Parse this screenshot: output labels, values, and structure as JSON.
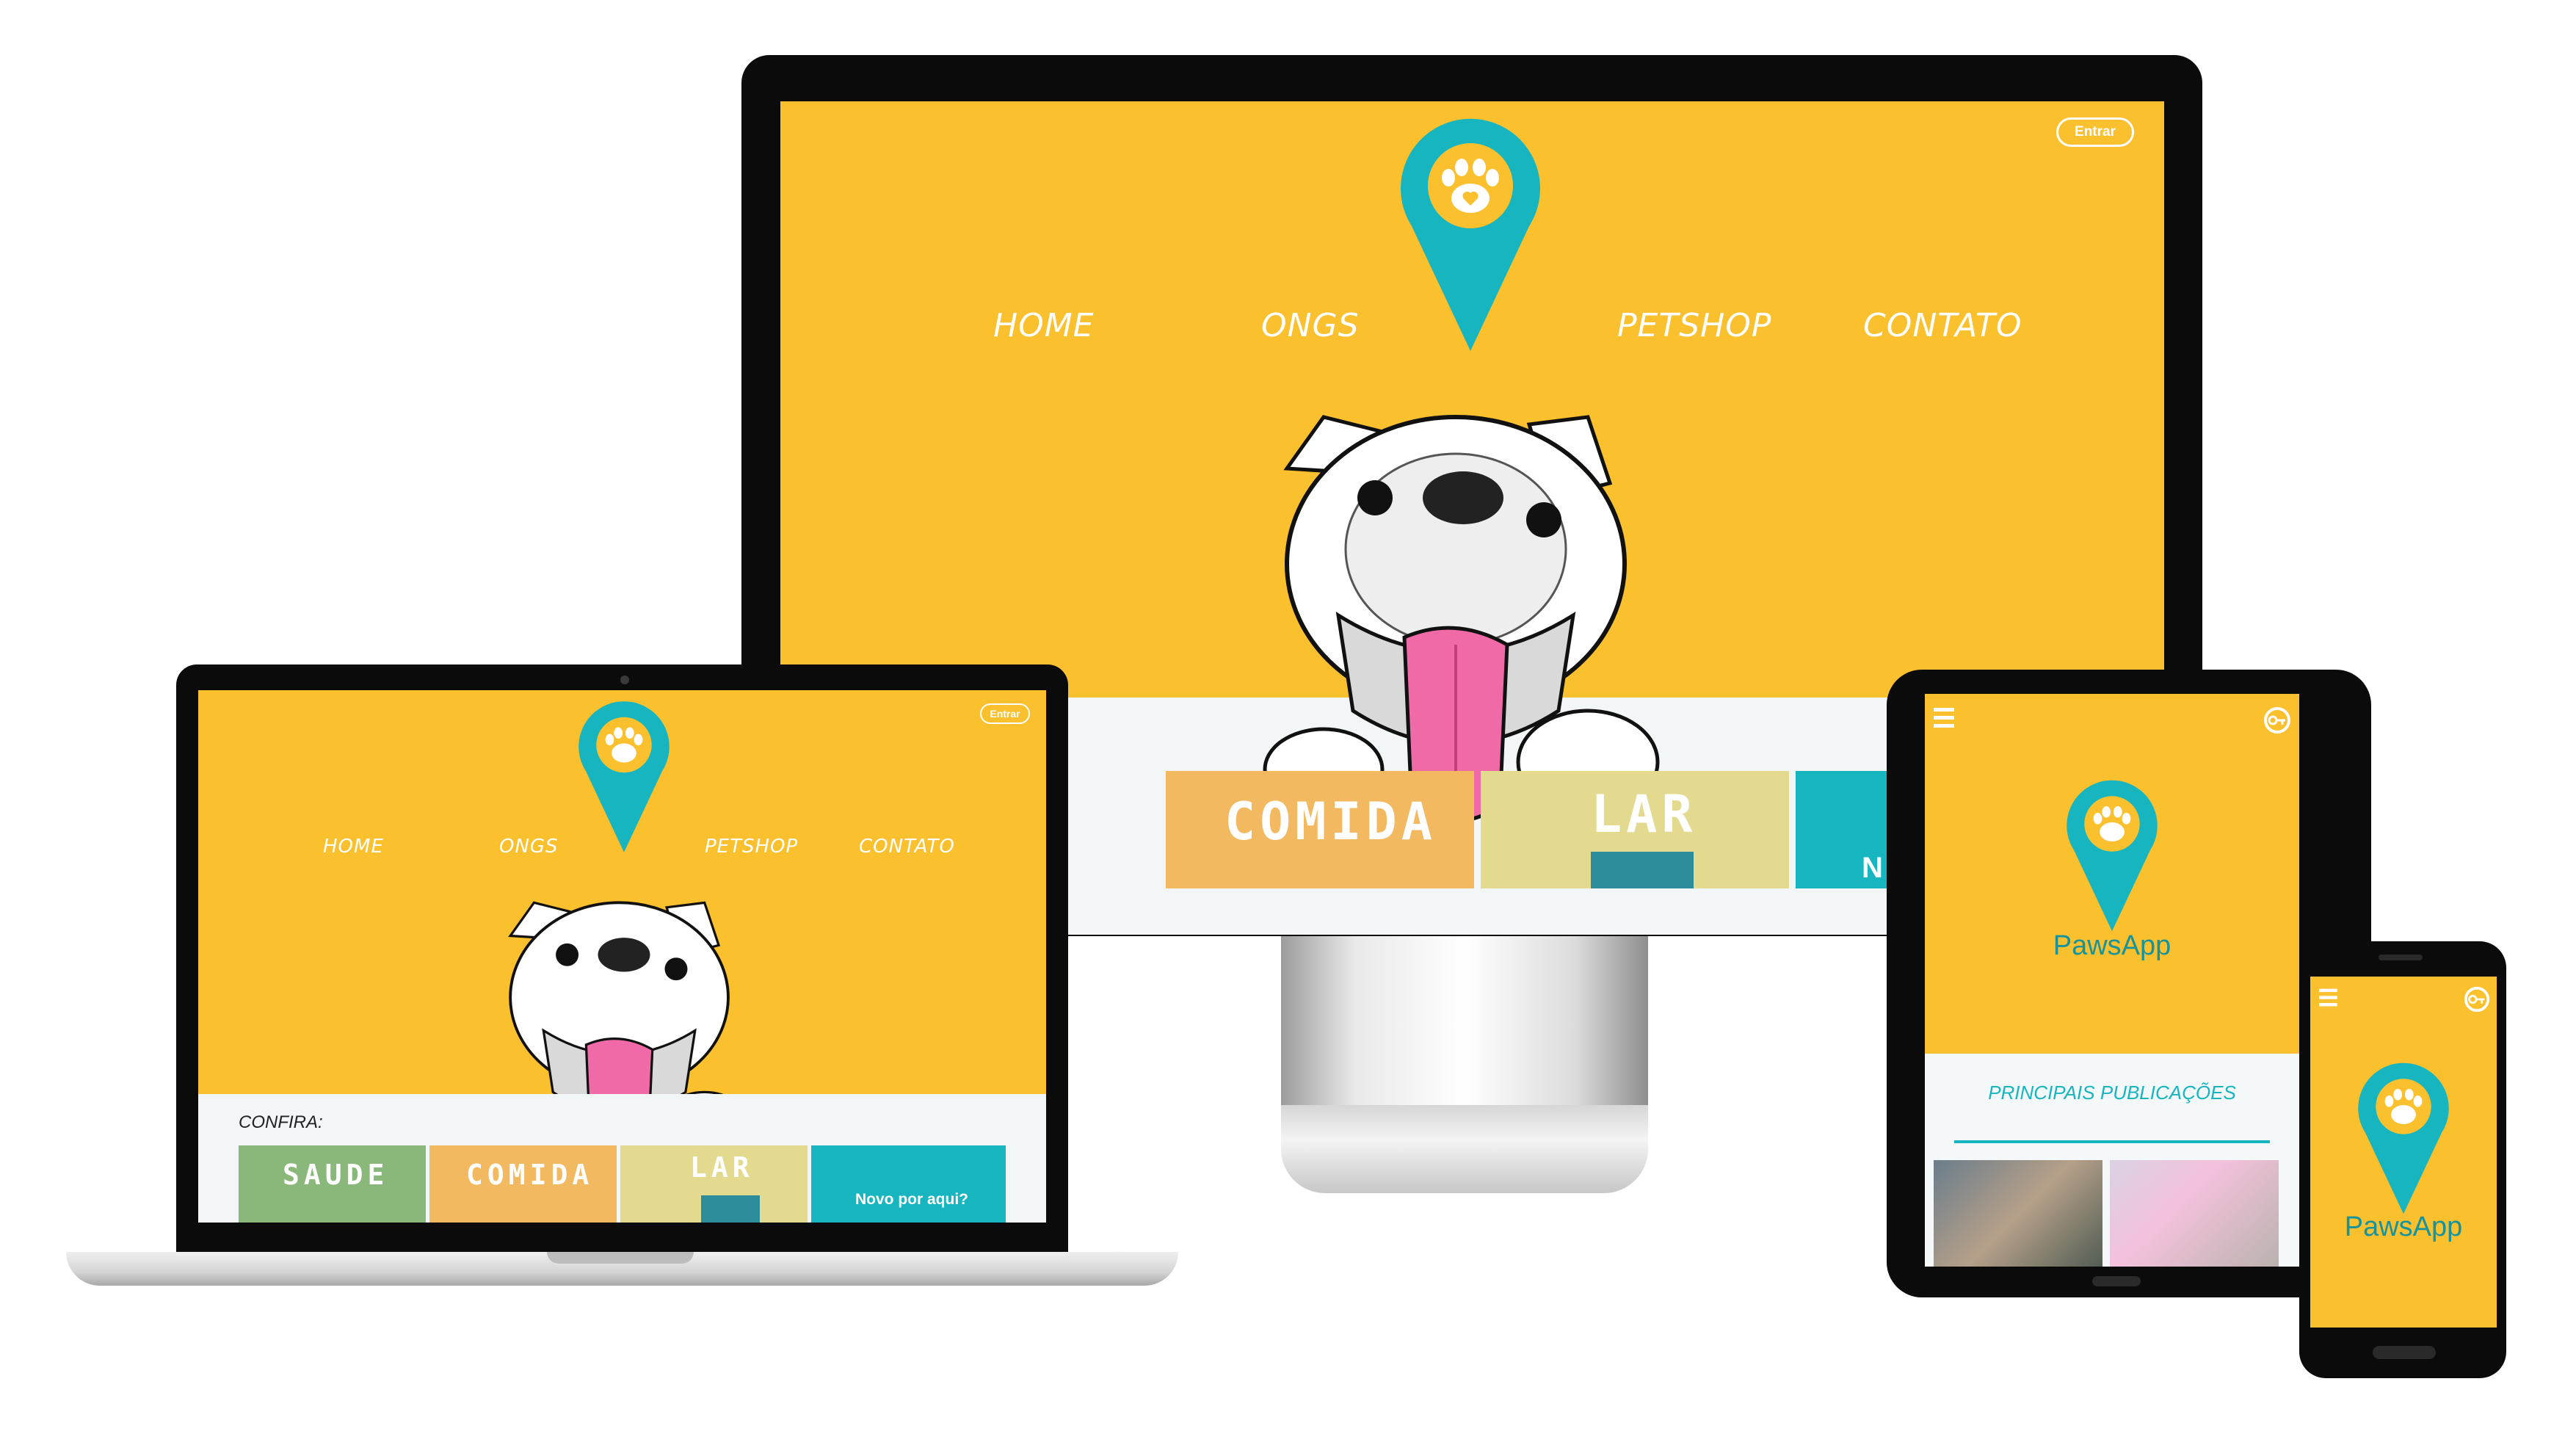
{
  "site": {
    "brand": "PawsApp",
    "login_label": "Entrar"
  },
  "nav": {
    "home": "HOME",
    "ongs": "ONGS",
    "petshop": "PETSHOP",
    "contato": "CONTATO"
  },
  "laptop": {
    "section_title": "CONFIRA:",
    "cards": [
      "SAUDE",
      "COMIDA",
      "LAR",
      "Novo por aqui?"
    ]
  },
  "desktop": {
    "cards": [
      "COMIDA",
      "LAR",
      "N"
    ]
  },
  "tablet": {
    "heading": "PRINCIPAIS PUBLICAÇÕES"
  },
  "colors": {
    "yellow": "#fbc02d",
    "teal": "#17b5c0",
    "pink": "#f06aa8",
    "white": "#ffffff"
  },
  "icons": [
    "location-pin-paw-icon",
    "paw-icon",
    "menu-icon",
    "login-key-icon",
    "bulldog-illustration"
  ]
}
